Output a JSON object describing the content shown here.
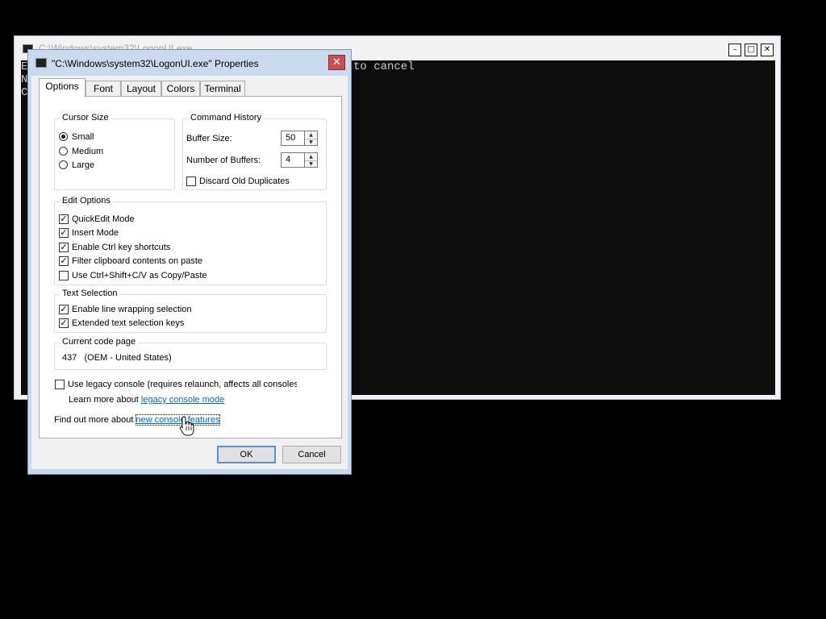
{
  "console_window": {
    "title": "C:\\Windows\\system32\\LogonUI.exe",
    "line_fragments": [
      "E",
      "N",
      "C"
    ],
    "visible_text": "to cancel",
    "controls": {
      "minimize_icon": "minimize-icon",
      "maximize_icon": "maximize-icon",
      "close_icon": "close-icon"
    }
  },
  "dialog": {
    "title": "\"C:\\Windows\\system32\\LogonUI.exe\" Properties",
    "close_glyph": "✕",
    "tabs": [
      {
        "label": "Options",
        "active": true
      },
      {
        "label": "Font",
        "active": false
      },
      {
        "label": "Layout",
        "active": false
      },
      {
        "label": "Colors",
        "active": false
      },
      {
        "label": "Terminal",
        "active": false
      }
    ],
    "cursor_size": {
      "legend": "Cursor Size",
      "options": [
        {
          "label": "Small",
          "selected": true
        },
        {
          "label": "Medium",
          "selected": false
        },
        {
          "label": "Large",
          "selected": false
        }
      ]
    },
    "command_history": {
      "legend": "Command History",
      "buffer_size_label": "Buffer Size:",
      "buffer_size_value": "50",
      "num_buffers_label": "Number of Buffers:",
      "num_buffers_value": "4",
      "discard_label": "Discard Old Duplicates",
      "discard_checked": false
    },
    "edit_options": {
      "legend": "Edit Options",
      "items": [
        {
          "label": "QuickEdit Mode",
          "checked": true
        },
        {
          "label": "Insert Mode",
          "checked": true
        },
        {
          "label": "Enable Ctrl key shortcuts",
          "checked": true
        },
        {
          "label": "Filter clipboard contents on paste",
          "checked": true
        },
        {
          "label": "Use Ctrl+Shift+C/V as Copy/Paste",
          "checked": false
        }
      ]
    },
    "text_selection": {
      "legend": "Text Selection",
      "items": [
        {
          "label": "Enable line wrapping selection",
          "checked": true
        },
        {
          "label": "Extended text selection keys",
          "checked": true
        }
      ]
    },
    "code_page": {
      "legend": "Current code page",
      "value": "437   (OEM - United States)"
    },
    "legacy": {
      "label": "Use legacy console (requires relaunch, affects all consoles",
      "checked": false,
      "learn_more_prefix": "Learn more about ",
      "learn_more_link": "legacy console mode"
    },
    "find_out_prefix": "Find out more about ",
    "find_out_link": "new console features",
    "ok_label": "OK",
    "cancel_label": "Cancel",
    "check_glyph": "✓",
    "spin_up_glyph": "▲",
    "spin_down_glyph": "▼"
  },
  "colors": {
    "desktop": "#000000",
    "dialog_frame": "#c9d9ee",
    "close_button": "#c75050",
    "link": "#0066cc"
  }
}
